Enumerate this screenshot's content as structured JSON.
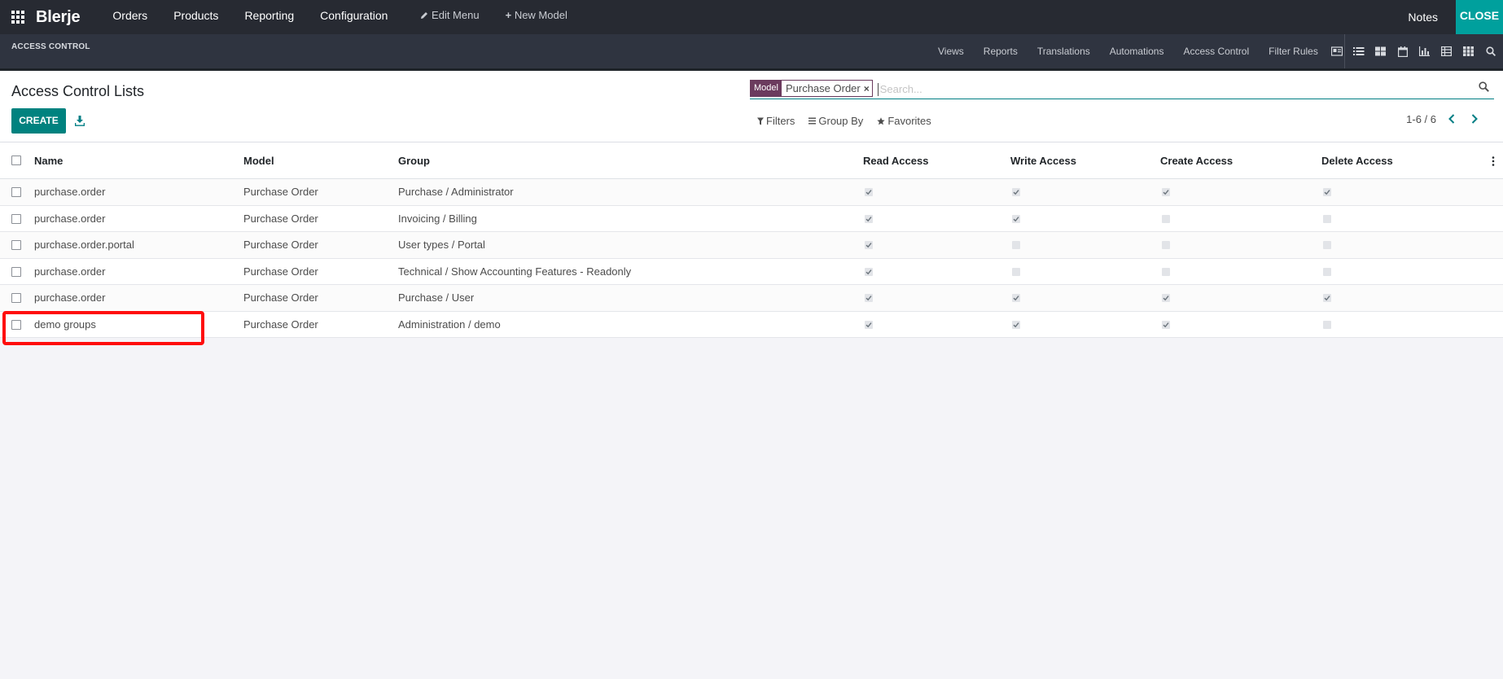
{
  "navbar": {
    "brand": "Blerje",
    "menu": [
      "Orders",
      "Products",
      "Reporting",
      "Configuration"
    ],
    "edit_menu": "Edit Menu",
    "new_model": "New Model",
    "notes": "Notes",
    "close": "CLOSE"
  },
  "subbar": {
    "section_title": "ACCESS CONTROL",
    "nav": [
      "Views",
      "Reports",
      "Translations",
      "Automations",
      "Access Control",
      "Filter Rules"
    ]
  },
  "control_panel": {
    "title": "Access Control Lists",
    "create_label": "CREATE",
    "search": {
      "facet_label": "Model",
      "facet_value": "Purchase Order",
      "placeholder": "Search..."
    },
    "filters_label": "Filters",
    "groupby_label": "Group By",
    "favorites_label": "Favorites",
    "pager": "1-6 / 6"
  },
  "table": {
    "columns": {
      "name": "Name",
      "model": "Model",
      "group": "Group",
      "read": "Read Access",
      "write": "Write Access",
      "create": "Create Access",
      "delete": "Delete Access"
    },
    "rows": [
      {
        "name": "purchase.order",
        "model": "Purchase Order",
        "group": "Purchase / Administrator",
        "read": true,
        "write": true,
        "create": true,
        "delete": true
      },
      {
        "name": "purchase.order",
        "model": "Purchase Order",
        "group": "Invoicing / Billing",
        "read": true,
        "write": true,
        "create": false,
        "delete": false
      },
      {
        "name": "purchase.order.portal",
        "model": "Purchase Order",
        "group": "User types / Portal",
        "read": true,
        "write": false,
        "create": false,
        "delete": false
      },
      {
        "name": "purchase.order",
        "model": "Purchase Order",
        "group": "Technical / Show Accounting Features - Readonly",
        "read": true,
        "write": false,
        "create": false,
        "delete": false
      },
      {
        "name": "purchase.order",
        "model": "Purchase Order",
        "group": "Purchase / User",
        "read": true,
        "write": true,
        "create": true,
        "delete": true
      },
      {
        "name": "demo groups",
        "model": "Purchase Order",
        "group": "Administration / demo",
        "read": true,
        "write": true,
        "create": true,
        "delete": false
      }
    ]
  },
  "colors": {
    "navbar_bg": "#272a32",
    "accent": "#00a09d",
    "primary_button": "#00827f",
    "facet": "#6b3b5e",
    "highlight": "#ff0d0d"
  }
}
